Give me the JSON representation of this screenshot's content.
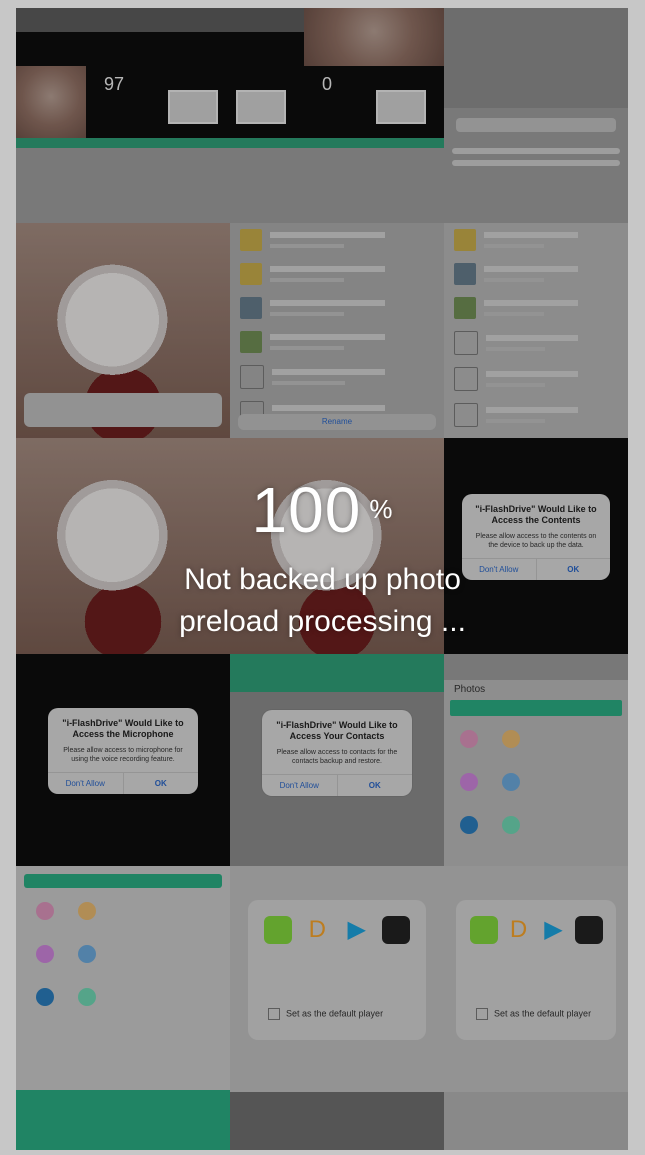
{
  "progress": {
    "value": "100",
    "symbol": "%"
  },
  "status": {
    "line1": "Not backed up photo",
    "line2": "preload processing ..."
  },
  "background": {
    "counts": [
      "97",
      "0"
    ],
    "dialogs": [
      {
        "title": "\"i-FlashDrive\" Would Like to Access the Contents",
        "body": "Please allow access to the contents on the device to back up the data.",
        "cancel": "Don't Allow",
        "ok": "OK"
      },
      {
        "title": "\"i-FlashDrive\" Would Like to Access the Microphone",
        "body": "Please allow access to microphone for using the voice recording feature.",
        "cancel": "Don't Allow",
        "ok": "OK"
      },
      {
        "title": "\"i-FlashDrive\" Would Like to Access Your Contacts",
        "body": "Please allow access to contacts for the contacts backup and restore.",
        "cancel": "Don't Allow",
        "ok": "OK"
      }
    ],
    "rename_label": "Rename",
    "set_default_label": "Set as the default player",
    "section_label": "Photos"
  },
  "colors": {
    "accent_green": "#2aa981",
    "overlay": "rgba(0,0,0,0.22)",
    "text": "#ffffff"
  }
}
